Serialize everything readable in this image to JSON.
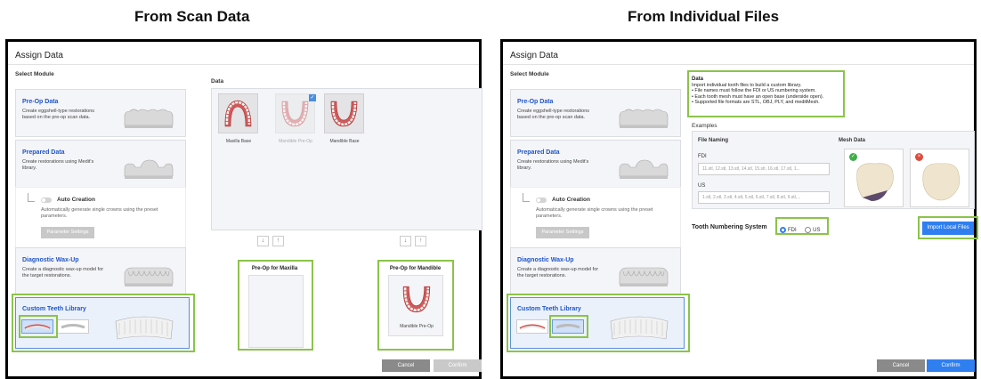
{
  "headings": {
    "left": "From Scan Data",
    "right": "From Individual Files"
  },
  "dialog": {
    "title": "Assign Data",
    "select_module": "Select Module",
    "cancel": "Cancel",
    "confirm": "Confirm"
  },
  "modules": {
    "preop": {
      "title": "Pre-Op Data",
      "desc": "Create eggshell-type restorations based on the pre-op scan data."
    },
    "prepared": {
      "title": "Prepared Data",
      "desc": "Create restorations using Medit's library."
    },
    "auto": {
      "title": "Auto Creation",
      "desc": "Automatically generate single crowns using the preset parameters.",
      "button": "Parameter Settings"
    },
    "waxup": {
      "title": "Diagnostic Wax-Up",
      "desc": "Create a diagnostic wax-up model for the target restorations."
    },
    "library": {
      "title": "Custom Teeth Library"
    }
  },
  "scan": {
    "data_label": "Data",
    "tiles": [
      "Maxilla Base",
      "Mandible Pre-Op",
      "Mandible Base"
    ],
    "arrows": [
      "↓",
      "↑"
    ],
    "preop_maxilla": "Pre-Op for Maxilla",
    "preop_mandible": "Pre-Op for Mandible",
    "mandible_preop_label": "Mandible Pre-Op",
    "check": "✓"
  },
  "files": {
    "info_title": "Data",
    "info_lines": [
      "Import individual tooth files to build a custom library.",
      "• File names must follow the FDI or US numbering system.",
      "• Each tooth mesh must have an open base (underside open).",
      "• Supported file formats are STL, OBJ, PLY, and meditMesh."
    ],
    "examples": "Examples",
    "file_naming": "File Naming",
    "fdi_label": "FDI",
    "fdi_value": "11.stl, 12.stl, 13.stl, 14.stl, 15.stl, 16.stl, 17.stl, 1...",
    "us_label": "US",
    "us_value": "1.stl, 2.stl, 3.stl, 4.stl, 5.stl, 6.stl, 7.stl, 8.stl, 9.stl,...",
    "mesh_data": "Mesh Data",
    "good_icon": "✓",
    "bad_icon": "×",
    "numbering_label": "Tooth Numbering System",
    "fdi": "FDI",
    "us": "US",
    "import": "Import Local Files"
  },
  "colors": {
    "highlight": "#8bc34a",
    "accent": "#2f7ff0",
    "module_title": "#1f55c8"
  }
}
